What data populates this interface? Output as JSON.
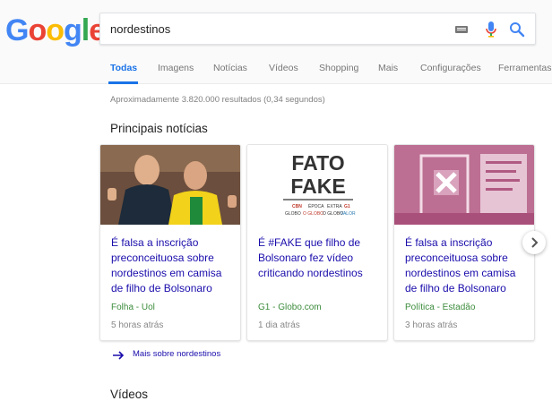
{
  "search": {
    "query": "nordestinos"
  },
  "logo": {
    "letters": [
      "G",
      "o",
      "o",
      "g",
      "l",
      "e"
    ]
  },
  "tabs": [
    {
      "label": "Todas"
    },
    {
      "label": "Imagens"
    },
    {
      "label": "Notícias"
    },
    {
      "label": "Vídeos"
    },
    {
      "label": "Shopping"
    },
    {
      "label": "Mais"
    },
    {
      "label": "Configurações"
    },
    {
      "label": "Ferramentas"
    }
  ],
  "results": {
    "stats": "Aproximadamente 3.820.000 resultados (0,34 segundos)"
  },
  "top_stories": {
    "heading": "Principais notícias",
    "cards": [
      {
        "title": "É falsa a inscrição preconceituosa sobre nordestinos em camisa de filho de Bolsonaro",
        "source": "Folha - Uol",
        "time": "5 horas atrás"
      },
      {
        "title": "É #FAKE que filho de Bolsonaro fez vídeo criticando nordestinos",
        "source": "G1 - Globo.com",
        "time": "1 dia atrás"
      },
      {
        "title": "É falsa a inscrição preconceituosa sobre nordestinos em camisa de filho de Bolsonaro",
        "source": "Política - Estadão",
        "time": "3 horas atrás"
      }
    ],
    "more_link": "Mais sobre nordestinos"
  },
  "fato_fake": {
    "line1": "FATO",
    "line2": "FAKE",
    "brands": [
      "CBN",
      "ÉPOCA",
      "EXTRA",
      "G1",
      "GLOBO",
      "O GLOBO",
      "VALOR"
    ]
  },
  "videos": {
    "heading": "Vídeos"
  },
  "colors": {
    "link": "#1a0dab",
    "accent": "#1a73e8",
    "source_green": "#3c8c3c"
  }
}
